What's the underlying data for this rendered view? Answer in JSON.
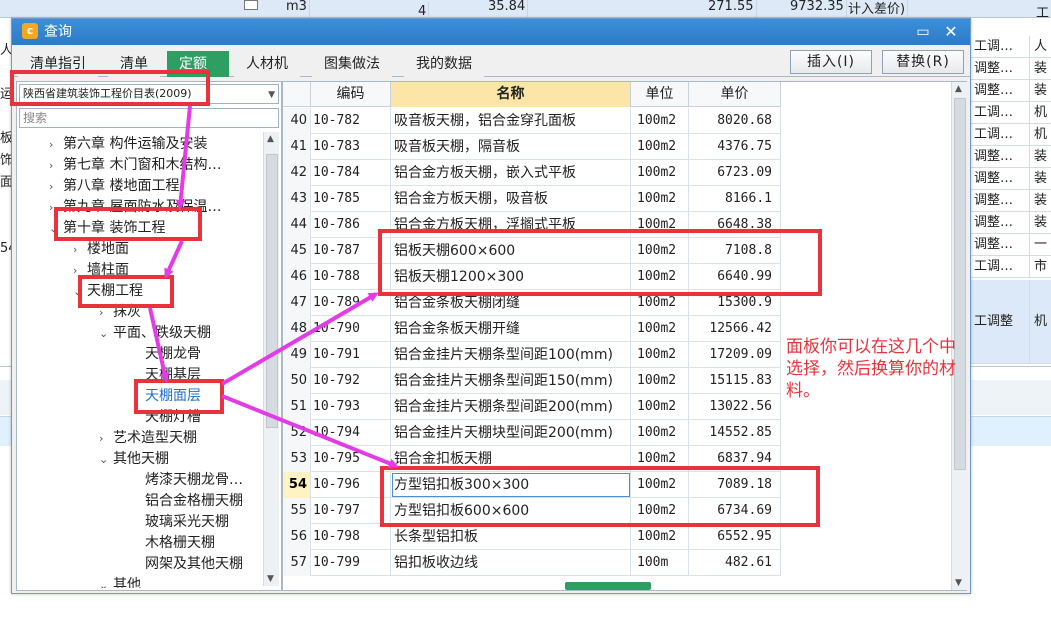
{
  "background": {
    "top_row": [
      "m3",
      "4",
      "35.84",
      "271.55",
      "9732.35",
      "计入差价)",
      "工"
    ],
    "right_rows": [
      [
        "工调…",
        "人"
      ],
      [
        "调整…",
        "装"
      ],
      [
        "调整…",
        "装"
      ],
      [
        "工调…",
        "机"
      ],
      [
        "工调…",
        "机"
      ],
      [
        "调整…",
        "装"
      ],
      [
        "调整…",
        "装"
      ],
      [
        "调整…",
        "装"
      ],
      [
        "调整…",
        "装"
      ],
      [
        "调整…",
        "一"
      ],
      [
        "工调…",
        "市"
      ],
      [
        "工调整",
        "机"
      ]
    ],
    "left_fragments": [
      "人",
      "运",
      "板",
      "饰面",
      "54"
    ]
  },
  "dialog": {
    "title": "查询",
    "icon_letter": "c",
    "tabs": [
      "清单指引",
      "清单",
      "定额",
      "人材机",
      "图集做法",
      "我的数据"
    ],
    "active_tab": "定额",
    "insert_button": "插入(I)",
    "replace_button": "替换(R)"
  },
  "library_select": "陕西省建筑装饰工程价目表(2009)",
  "search_placeholder": "搜索",
  "tree": [
    {
      "label": "第六章  构件运输及安装",
      "caret": "›"
    },
    {
      "label": "第七章  木门窗和木结构…",
      "caret": "›"
    },
    {
      "label": "第八章  楼地面工程",
      "caret": "›"
    },
    {
      "label": "第九章  屋面防水及保温…",
      "caret": "›"
    },
    {
      "label": "第十章  装饰工程",
      "caret": "⌄"
    },
    {
      "label": "楼地面",
      "caret": "›"
    },
    {
      "label": "墙柱面",
      "caret": "›"
    },
    {
      "label": "天棚工程",
      "caret": "⌄"
    },
    {
      "label": "抹灰",
      "caret": "›"
    },
    {
      "label": "平面、跌级天棚",
      "caret": "⌄"
    },
    {
      "label": "天棚龙骨",
      "caret": ""
    },
    {
      "label": "天棚基层",
      "caret": ""
    },
    {
      "label": "天棚面层",
      "caret": ""
    },
    {
      "label": "天棚灯槽",
      "caret": ""
    },
    {
      "label": "艺术造型天棚",
      "caret": "›"
    },
    {
      "label": "其他天棚",
      "caret": "⌄"
    },
    {
      "label": "烤漆天棚龙骨…",
      "caret": ""
    },
    {
      "label": "铝合金格栅天棚",
      "caret": ""
    },
    {
      "label": "玻璃采光天棚",
      "caret": ""
    },
    {
      "label": "木格栅天棚",
      "caret": ""
    },
    {
      "label": "网架及其他天棚",
      "caret": ""
    },
    {
      "label": "其他",
      "caret": "⌄"
    }
  ],
  "grid": {
    "columns": [
      "编码",
      "名称",
      "单位",
      "单价"
    ],
    "current_row": "54",
    "rows": [
      {
        "n": "40",
        "code": "10-782",
        "name": "吸音板天棚，铝合金穿孔面板",
        "unit": "100m2",
        "price": "8020.68"
      },
      {
        "n": "41",
        "code": "10-783",
        "name": "吸音板天棚，隔音板",
        "unit": "100m2",
        "price": "4376.75"
      },
      {
        "n": "42",
        "code": "10-784",
        "name": "铝合金方板天棚，嵌入式平板",
        "unit": "100m2",
        "price": "6723.09"
      },
      {
        "n": "43",
        "code": "10-785",
        "name": "铝合金方板天棚，吸音板",
        "unit": "100m2",
        "price": "8166.1"
      },
      {
        "n": "44",
        "code": "10-786",
        "name": "铝合金方板天棚，浮搁式平板",
        "unit": "100m2",
        "price": "6648.38"
      },
      {
        "n": "45",
        "code": "10-787",
        "name": "铝板天棚600×600",
        "unit": "100m2",
        "price": "7108.8"
      },
      {
        "n": "46",
        "code": "10-788",
        "name": "铝板天棚1200×300",
        "unit": "100m2",
        "price": "6640.99"
      },
      {
        "n": "47",
        "code": "10-789",
        "name": "铝合金条板天棚闭缝",
        "unit": "100m2",
        "price": "15300.9"
      },
      {
        "n": "48",
        "code": "10-790",
        "name": "铝合金条板天棚开缝",
        "unit": "100m2",
        "price": "12566.42"
      },
      {
        "n": "49",
        "code": "10-791",
        "name": "铝合金挂片天棚条型间距100(mm)",
        "unit": "100m2",
        "price": "17209.09"
      },
      {
        "n": "50",
        "code": "10-792",
        "name": "铝合金挂片天棚条型间距150(mm)",
        "unit": "100m2",
        "price": "15115.83"
      },
      {
        "n": "51",
        "code": "10-793",
        "name": "铝合金挂片天棚条型间距200(mm)",
        "unit": "100m2",
        "price": "13022.56"
      },
      {
        "n": "52",
        "code": "10-794",
        "name": "铝合金挂片天棚块型间距200(mm)",
        "unit": "100m2",
        "price": "14552.85"
      },
      {
        "n": "53",
        "code": "10-795",
        "name": "铝合金扣板天棚",
        "unit": "100m2",
        "price": "6837.94"
      },
      {
        "n": "54",
        "code": "10-796",
        "name": "方型铝扣板300×300",
        "unit": "100m2",
        "price": "7089.18"
      },
      {
        "n": "55",
        "code": "10-797",
        "name": "方型铝扣板600×600",
        "unit": "100m2",
        "price": "6734.69"
      },
      {
        "n": "56",
        "code": "10-798",
        "name": "长条型铝扣板",
        "unit": "100m2",
        "price": "6552.95"
      },
      {
        "n": "57",
        "code": "10-799",
        "name": "铝扣板收边线",
        "unit": "100m",
        "price": "482.61"
      }
    ]
  },
  "annotation_text": "面板你可以在这几个中选择，然后换算你的材料。",
  "colors": {
    "highlight": "#e8323c",
    "arrow": "#e33be6",
    "active_tab": "#2f9e63",
    "title_bar": "#2b7bc8"
  }
}
